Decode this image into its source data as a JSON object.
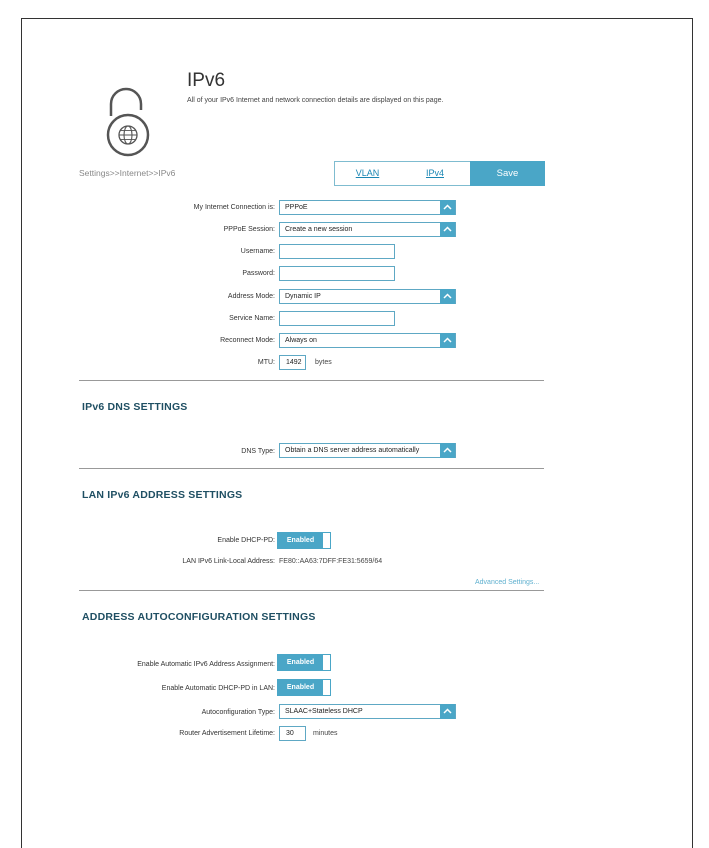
{
  "header": {
    "title": "IPv6",
    "description": "All of your IPv6 Internet and network connection details are displayed on this page."
  },
  "breadcrumb": "Settings>>Internet>>IPv6",
  "tabs": {
    "vlan": "VLAN",
    "ipv4": "IPv4",
    "save": "Save"
  },
  "internet": {
    "connection_label": "My Internet Connection is:",
    "connection_value": "PPPoE",
    "session_label": "PPPoE Session:",
    "session_value": "Create a new session",
    "username_label": "Username:",
    "username_value": "",
    "password_label": "Password:",
    "password_value": "",
    "address_mode_label": "Address Mode:",
    "address_mode_value": "Dynamic IP",
    "service_name_label": "Service Name:",
    "service_name_value": "",
    "reconnect_label": "Reconnect Mode:",
    "reconnect_value": "Always on",
    "mtu_label": "MTU:",
    "mtu_value": "1492",
    "mtu_unit": "bytes"
  },
  "dns": {
    "section_title": "IPv6 DNS SETTINGS",
    "type_label": "DNS Type:",
    "type_value": "Obtain a DNS server address automatically"
  },
  "lan": {
    "section_title": "LAN IPv6 ADDRESS SETTINGS",
    "dhcp_pd_label": "Enable DHCP-PD:",
    "dhcp_pd_value": "Enabled",
    "link_local_label": "LAN IPv6 Link-Local Address:",
    "link_local_value": "FE80::AA63:7DFF:FE31:5659/64",
    "advanced_link": "Advanced Settings..."
  },
  "autoconf": {
    "section_title": "ADDRESS AUTOCONFIGURATION SETTINGS",
    "auto_assign_label": "Enable Automatic IPv6 Address Assignment:",
    "auto_assign_value": "Enabled",
    "auto_pd_label": "Enable Automatic DHCP-PD in LAN:",
    "auto_pd_value": "Enabled",
    "type_label": "Autoconfiguration Type:",
    "type_value": "SLAAC+Stateless DHCP",
    "lifetime_label": "Router Advertisement Lifetime:",
    "lifetime_value": "30",
    "lifetime_unit": "minutes"
  },
  "colors": {
    "accent": "#4aa6c7",
    "section_title": "#1f4f63",
    "link": "#1a86b3"
  },
  "icons": {
    "lock": "unlocked-globe-icon",
    "chevron": "chevron-up-icon"
  }
}
